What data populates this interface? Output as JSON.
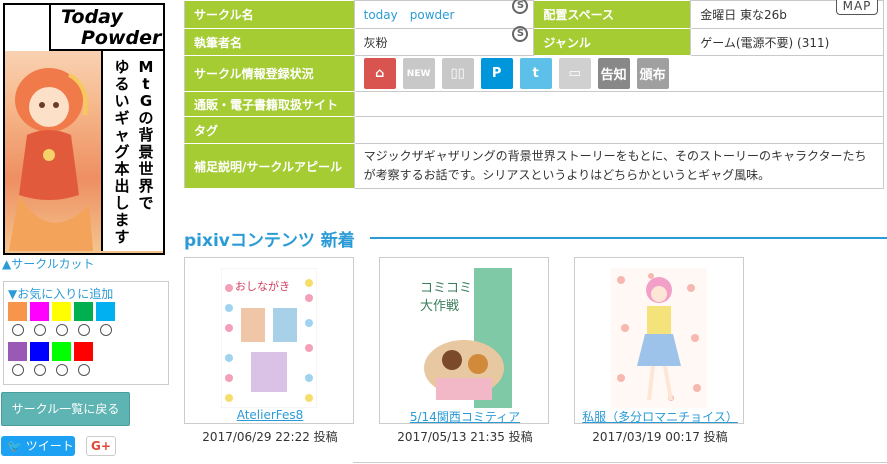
{
  "circle_cut": {
    "title_line1": "Today",
    "title_line2": "Powder",
    "vertical_text_col1": "MtGの背景世界で",
    "vertical_text_col2": "ゆるいギャグ本出します"
  },
  "left_panel": {
    "circle_cut_link": "▲サークルカット",
    "favorites_title": "▼お気に入りに追加",
    "favorite_colors_row1": [
      "#f7964b",
      "#ff00ff",
      "#ffff00",
      "#00b050",
      "#00b0f0"
    ],
    "favorite_colors_row2": [
      "#9b59b6",
      "#0000ff",
      "#00ff00",
      "#ff0000"
    ],
    "back_button": "サークル一覧に戻る",
    "tweet_button": "ツイート",
    "gplus_button": "G+"
  },
  "info": {
    "circle_name_label": "サークル名",
    "circle_name_value": "today　powder",
    "space_label": "配置スペース",
    "space_value": "金曜日 東な26b",
    "map_button": "MAP",
    "author_label": "執筆者名",
    "author_value": "灰粉",
    "genre_label": "ジャンル",
    "genre_value": "ゲーム(電源不要) (311)",
    "status_label": "サークル情報登録状況",
    "status_icons": [
      {
        "name": "home",
        "text": "⌂",
        "color": "#d9534f"
      },
      {
        "name": "new",
        "text": "NEW",
        "color": "#c8c8c8"
      },
      {
        "name": "book",
        "text": "▯▯",
        "color": "#c8c8c8"
      },
      {
        "name": "pixiv",
        "text": "P",
        "color": "#0096db"
      },
      {
        "name": "tumblr",
        "text": "t",
        "color": "#5cc0e8"
      },
      {
        "name": "tv",
        "text": "▭",
        "color": "#d0d0d0"
      },
      {
        "name": "announce",
        "text": "告知",
        "color": "#888888"
      },
      {
        "name": "distribute",
        "text": "頒布",
        "color": "#a0a0a0"
      }
    ],
    "shop_label": "通販・電子書籍取扱サイト",
    "shop_value": "",
    "tag_label": "タグ",
    "tag_value": "",
    "appeal_label": "補足説明/サークルアピール",
    "appeal_value": "マジックザギャザリングの背景世界ストーリーをもとに、そのストーリーのキャラクターたちが考察するお話です。シリアスというよりはどちらかというとギャグ風味。"
  },
  "pixiv": {
    "heading": "pixivコンテンツ 新着",
    "works": [
      {
        "title": "AtelierFes8",
        "date": "2017/06/29 22:22 投稿"
      },
      {
        "title": "5/14関西コミティア",
        "date": "2017/05/13 21:35 投稿"
      },
      {
        "title": "私服（多分ロマニチョイス）",
        "date": "2017/03/19 00:17 投稿"
      }
    ]
  }
}
